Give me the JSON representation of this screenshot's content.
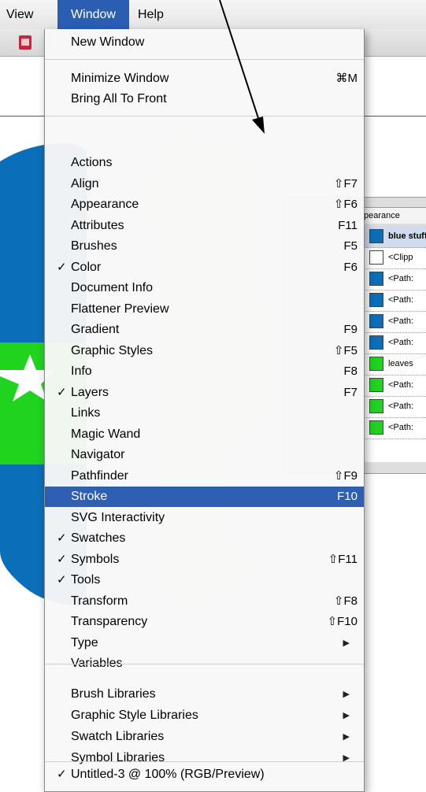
{
  "menubar": {
    "view": "View",
    "window": "Window",
    "help": "Help"
  },
  "document": {
    "title_strip": "Untitled-3 @ 100% (RGB/Preview)"
  },
  "layers_palette": {
    "tab": "pearance",
    "rows": [
      {
        "label": "blue stuff",
        "color": "#0a6fb8"
      },
      {
        "label": "<Clipp",
        "color": "#ffffff"
      },
      {
        "label": "<Path:",
        "color": "#0a6fb8"
      },
      {
        "label": "<Path:",
        "color": "#0a6fb8"
      },
      {
        "label": "<Path:",
        "color": "#0a6fb8"
      },
      {
        "label": "<Path:",
        "color": "#0a6fb8"
      },
      {
        "label": "leaves",
        "color": "#1fd31f"
      },
      {
        "label": "<Path:",
        "color": "#1fd31f"
      },
      {
        "label": "<Path:",
        "color": "#1fd31f"
      },
      {
        "label": "<Path:",
        "color": "#1fd31f"
      }
    ]
  },
  "menu": {
    "new_window": "New Window",
    "minimize": {
      "label": "Minimize Window",
      "shortcut": "⌘M"
    },
    "bring_all": "Bring All To Front",
    "palettes": [
      {
        "label": "Actions",
        "shortcut": "",
        "checked": false,
        "selected": false
      },
      {
        "label": "Align",
        "shortcut": "⇧F7",
        "checked": false,
        "selected": false
      },
      {
        "label": "Appearance",
        "shortcut": "⇧F6",
        "checked": false,
        "selected": false
      },
      {
        "label": "Attributes",
        "shortcut": "F11",
        "checked": false,
        "selected": false
      },
      {
        "label": "Brushes",
        "shortcut": "F5",
        "checked": false,
        "selected": false
      },
      {
        "label": "Color",
        "shortcut": "F6",
        "checked": true,
        "selected": false
      },
      {
        "label": "Document Info",
        "shortcut": "",
        "checked": false,
        "selected": false
      },
      {
        "label": "Flattener Preview",
        "shortcut": "",
        "checked": false,
        "selected": false
      },
      {
        "label": "Gradient",
        "shortcut": "F9",
        "checked": false,
        "selected": false
      },
      {
        "label": "Graphic Styles",
        "shortcut": "⇧F5",
        "checked": false,
        "selected": false
      },
      {
        "label": "Info",
        "shortcut": "F8",
        "checked": false,
        "selected": false
      },
      {
        "label": "Layers",
        "shortcut": "F7",
        "checked": true,
        "selected": false
      },
      {
        "label": "Links",
        "shortcut": "",
        "checked": false,
        "selected": false
      },
      {
        "label": "Magic Wand",
        "shortcut": "",
        "checked": false,
        "selected": false
      },
      {
        "label": "Navigator",
        "shortcut": "",
        "checked": false,
        "selected": false
      },
      {
        "label": "Pathfinder",
        "shortcut": "⇧F9",
        "checked": false,
        "selected": false
      },
      {
        "label": "Stroke",
        "shortcut": "F10",
        "checked": false,
        "selected": true
      },
      {
        "label": "SVG Interactivity",
        "shortcut": "",
        "checked": false,
        "selected": false
      },
      {
        "label": "Swatches",
        "shortcut": "",
        "checked": true,
        "selected": false
      },
      {
        "label": "Symbols",
        "shortcut": "⇧F11",
        "checked": true,
        "selected": false
      },
      {
        "label": "Tools",
        "shortcut": "",
        "checked": true,
        "selected": false
      },
      {
        "label": "Transform",
        "shortcut": "⇧F8",
        "checked": false,
        "selected": false
      },
      {
        "label": "Transparency",
        "shortcut": "⇧F10",
        "checked": false,
        "selected": false
      },
      {
        "label": "Type",
        "shortcut": "",
        "checked": false,
        "selected": false,
        "submenu": true
      },
      {
        "label": "Variables",
        "shortcut": "",
        "checked": false,
        "selected": false
      }
    ],
    "libraries": [
      {
        "label": "Brush Libraries"
      },
      {
        "label": "Graphic Style Libraries"
      },
      {
        "label": "Swatch Libraries"
      },
      {
        "label": "Symbol Libraries"
      }
    ],
    "document_window": {
      "label": "Untitled-3 @ 100% (RGB/Preview)",
      "checked": true
    },
    "check_glyph": "✓",
    "submenu_glyph": "▶"
  },
  "colors": {
    "selection": "#2f5fb3",
    "menubar_highlight": "#2a5eb3",
    "artwork_blue": "#0a6fb8",
    "artwork_green": "#1fd31f",
    "ghost_green": "#d9f2cf"
  }
}
